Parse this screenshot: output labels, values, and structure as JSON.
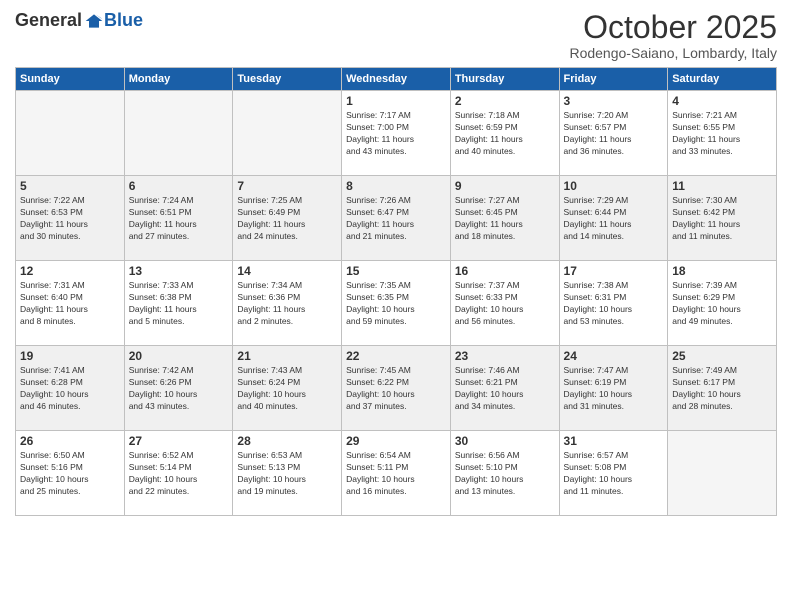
{
  "logo": {
    "general": "General",
    "blue": "Blue"
  },
  "header": {
    "month": "October 2025",
    "location": "Rodengo-Saiano, Lombardy, Italy"
  },
  "days_of_week": [
    "Sunday",
    "Monday",
    "Tuesday",
    "Wednesday",
    "Thursday",
    "Friday",
    "Saturday"
  ],
  "weeks": [
    {
      "shaded": false,
      "days": [
        {
          "num": "",
          "info": ""
        },
        {
          "num": "",
          "info": ""
        },
        {
          "num": "",
          "info": ""
        },
        {
          "num": "1",
          "info": "Sunrise: 7:17 AM\nSunset: 7:00 PM\nDaylight: 11 hours\nand 43 minutes."
        },
        {
          "num": "2",
          "info": "Sunrise: 7:18 AM\nSunset: 6:59 PM\nDaylight: 11 hours\nand 40 minutes."
        },
        {
          "num": "3",
          "info": "Sunrise: 7:20 AM\nSunset: 6:57 PM\nDaylight: 11 hours\nand 36 minutes."
        },
        {
          "num": "4",
          "info": "Sunrise: 7:21 AM\nSunset: 6:55 PM\nDaylight: 11 hours\nand 33 minutes."
        }
      ]
    },
    {
      "shaded": true,
      "days": [
        {
          "num": "5",
          "info": "Sunrise: 7:22 AM\nSunset: 6:53 PM\nDaylight: 11 hours\nand 30 minutes."
        },
        {
          "num": "6",
          "info": "Sunrise: 7:24 AM\nSunset: 6:51 PM\nDaylight: 11 hours\nand 27 minutes."
        },
        {
          "num": "7",
          "info": "Sunrise: 7:25 AM\nSunset: 6:49 PM\nDaylight: 11 hours\nand 24 minutes."
        },
        {
          "num": "8",
          "info": "Sunrise: 7:26 AM\nSunset: 6:47 PM\nDaylight: 11 hours\nand 21 minutes."
        },
        {
          "num": "9",
          "info": "Sunrise: 7:27 AM\nSunset: 6:45 PM\nDaylight: 11 hours\nand 18 minutes."
        },
        {
          "num": "10",
          "info": "Sunrise: 7:29 AM\nSunset: 6:44 PM\nDaylight: 11 hours\nand 14 minutes."
        },
        {
          "num": "11",
          "info": "Sunrise: 7:30 AM\nSunset: 6:42 PM\nDaylight: 11 hours\nand 11 minutes."
        }
      ]
    },
    {
      "shaded": false,
      "days": [
        {
          "num": "12",
          "info": "Sunrise: 7:31 AM\nSunset: 6:40 PM\nDaylight: 11 hours\nand 8 minutes."
        },
        {
          "num": "13",
          "info": "Sunrise: 7:33 AM\nSunset: 6:38 PM\nDaylight: 11 hours\nand 5 minutes."
        },
        {
          "num": "14",
          "info": "Sunrise: 7:34 AM\nSunset: 6:36 PM\nDaylight: 11 hours\nand 2 minutes."
        },
        {
          "num": "15",
          "info": "Sunrise: 7:35 AM\nSunset: 6:35 PM\nDaylight: 10 hours\nand 59 minutes."
        },
        {
          "num": "16",
          "info": "Sunrise: 7:37 AM\nSunset: 6:33 PM\nDaylight: 10 hours\nand 56 minutes."
        },
        {
          "num": "17",
          "info": "Sunrise: 7:38 AM\nSunset: 6:31 PM\nDaylight: 10 hours\nand 53 minutes."
        },
        {
          "num": "18",
          "info": "Sunrise: 7:39 AM\nSunset: 6:29 PM\nDaylight: 10 hours\nand 49 minutes."
        }
      ]
    },
    {
      "shaded": true,
      "days": [
        {
          "num": "19",
          "info": "Sunrise: 7:41 AM\nSunset: 6:28 PM\nDaylight: 10 hours\nand 46 minutes."
        },
        {
          "num": "20",
          "info": "Sunrise: 7:42 AM\nSunset: 6:26 PM\nDaylight: 10 hours\nand 43 minutes."
        },
        {
          "num": "21",
          "info": "Sunrise: 7:43 AM\nSunset: 6:24 PM\nDaylight: 10 hours\nand 40 minutes."
        },
        {
          "num": "22",
          "info": "Sunrise: 7:45 AM\nSunset: 6:22 PM\nDaylight: 10 hours\nand 37 minutes."
        },
        {
          "num": "23",
          "info": "Sunrise: 7:46 AM\nSunset: 6:21 PM\nDaylight: 10 hours\nand 34 minutes."
        },
        {
          "num": "24",
          "info": "Sunrise: 7:47 AM\nSunset: 6:19 PM\nDaylight: 10 hours\nand 31 minutes."
        },
        {
          "num": "25",
          "info": "Sunrise: 7:49 AM\nSunset: 6:17 PM\nDaylight: 10 hours\nand 28 minutes."
        }
      ]
    },
    {
      "shaded": false,
      "days": [
        {
          "num": "26",
          "info": "Sunrise: 6:50 AM\nSunset: 5:16 PM\nDaylight: 10 hours\nand 25 minutes."
        },
        {
          "num": "27",
          "info": "Sunrise: 6:52 AM\nSunset: 5:14 PM\nDaylight: 10 hours\nand 22 minutes."
        },
        {
          "num": "28",
          "info": "Sunrise: 6:53 AM\nSunset: 5:13 PM\nDaylight: 10 hours\nand 19 minutes."
        },
        {
          "num": "29",
          "info": "Sunrise: 6:54 AM\nSunset: 5:11 PM\nDaylight: 10 hours\nand 16 minutes."
        },
        {
          "num": "30",
          "info": "Sunrise: 6:56 AM\nSunset: 5:10 PM\nDaylight: 10 hours\nand 13 minutes."
        },
        {
          "num": "31",
          "info": "Sunrise: 6:57 AM\nSunset: 5:08 PM\nDaylight: 10 hours\nand 11 minutes."
        },
        {
          "num": "",
          "info": ""
        }
      ]
    }
  ]
}
